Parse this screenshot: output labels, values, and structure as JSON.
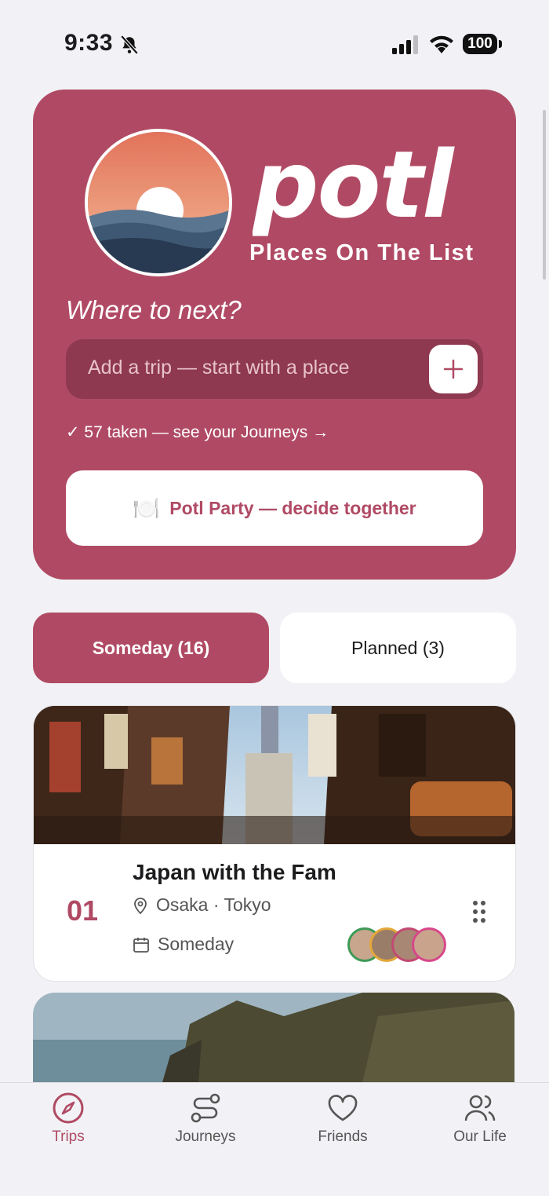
{
  "status_bar": {
    "time": "9:33",
    "battery": "100"
  },
  "hero": {
    "brand": "potl",
    "tagline": "Places On The List",
    "prompt": "Where to next?",
    "add_trip_placeholder": "Add a trip — start with a place",
    "taken_link": "✓ 57 taken — see your Journeys →",
    "party_button": "Potl Party — decide together",
    "party_icon": "🍽️",
    "accent_color": "#b04a64"
  },
  "tabs": [
    {
      "label": "Someday (16)",
      "active": true
    },
    {
      "label": "Planned (3)",
      "active": false
    }
  ],
  "trips": [
    {
      "number": "01",
      "title": "Japan with the Fam",
      "places": "Osaka · Tokyo",
      "when": "Someday"
    }
  ],
  "nav": [
    {
      "label": "Trips",
      "icon": "compass-icon",
      "active": true
    },
    {
      "label": "Journeys",
      "icon": "route-icon",
      "active": false
    },
    {
      "label": "Friends",
      "icon": "heart-icon",
      "active": false
    },
    {
      "label": "Our Life",
      "icon": "users-icon",
      "active": false
    }
  ]
}
